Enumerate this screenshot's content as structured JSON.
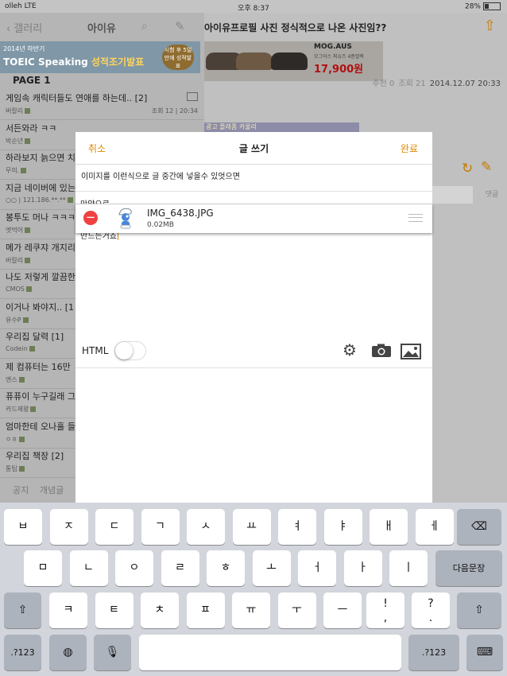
{
  "status": {
    "carrier": "olleh",
    "network": "LTE",
    "time": "오후 8:37",
    "battery": "28%"
  },
  "left": {
    "back": "갤러리",
    "title": "아이유",
    "banner": {
      "year": "2014년 하반기",
      "title_white": "TOEIC Speaking ",
      "title_yellow": "성적조기발표",
      "badge": "시험 후 5일 만에 성적발표"
    },
    "page": "PAGE 1",
    "posts": [
      {
        "title": "게임속 캐릭터들도 연애를 하는데..",
        "count": "[2]",
        "author": "버칼리",
        "stats": "조회 12 | 20:34",
        "image": true
      },
      {
        "title": "서든와라 ㅋㅋ",
        "count": "",
        "author": "박순년",
        "stats": ""
      },
      {
        "title": "하라보지 늙으면 치",
        "count": "",
        "author": "무의.",
        "stats": ""
      },
      {
        "title": "지금 네이버에 있는",
        "count": "",
        "author": "○○ | 121.186.**.**",
        "stats": ""
      },
      {
        "title": "봉투도 머나 ㅋㅋㅋ",
        "count": "",
        "author": "엣먹어",
        "stats": ""
      },
      {
        "title": "메가 레쿠쟈 개지리",
        "count": "",
        "author": "버칼리",
        "stats": ""
      },
      {
        "title": "나도 저렇게 깔끔한",
        "count": "",
        "author": "CMOS",
        "stats": ""
      },
      {
        "title": "이거나 봐야지..",
        "count": "[1",
        "author": "유수P",
        "stats": ""
      },
      {
        "title": "우리집 달력",
        "count": "[1]",
        "author": "Codein",
        "stats": ""
      },
      {
        "title": "제 컴퓨터는 16만",
        "count": "",
        "author": "앤스",
        "stats": ""
      },
      {
        "title": "퓨퓨이 누구길래 그",
        "count": "",
        "author": "카드제왕",
        "stats": ""
      },
      {
        "title": "엄마한테 오나홀 들",
        "count": "",
        "author": "ㅇㅎ",
        "stats": ""
      },
      {
        "title": "우리집 책장",
        "count": "[2]",
        "author": "통팁",
        "stats": ""
      }
    ],
    "bottom": {
      "notice": "공지",
      "concept": "개념글"
    }
  },
  "right": {
    "title": "아이유프로필 사진 정식적으로 나온 사진임??",
    "ad": {
      "brand": "MOG.AUS",
      "sub": "모그어스 퍼슈즈 4종컬렉",
      "price": "17,900원"
    },
    "meta": {
      "recommend": "추천 0",
      "views": "조회 21",
      "date": "2014.12.07 20:33"
    },
    "adbar": "광고 플래폼 카울리",
    "reply": "댓글"
  },
  "modal": {
    "cancel": "취소",
    "title": "글 쓰기",
    "done": "완료",
    "subject": "이미지를 이런식으로 글 중간에 넣을수 있엇으면",
    "body_top": "만약으로",
    "body_bottom": "만드는거죠",
    "attachment": {
      "name": "IMG_6438.JPG",
      "size": "0.02MB"
    },
    "html_label": "HTML",
    "html_on": false
  },
  "keyboard": {
    "row1": [
      "ㅂ",
      "ㅈ",
      "ㄷ",
      "ㄱ",
      "ㅅ",
      "ㅛ",
      "ㅕ",
      "ㅑ",
      "ㅐ",
      "ㅔ"
    ],
    "row2": [
      "ㅁ",
      "ㄴ",
      "ㅇ",
      "ㄹ",
      "ㅎ",
      "ㅗ",
      "ㅓ",
      "ㅏ",
      "ㅣ"
    ],
    "return": "다음문장",
    "row3": [
      "ㅋ",
      "ㅌ",
      "ㅊ",
      "ㅍ",
      "ㅠ",
      "ㅜ",
      "ㅡ"
    ],
    "punct1": "!",
    "punct1b": ",",
    "punct2": "?",
    "punct2b": ".",
    "num": ".?123"
  },
  "colors": {
    "accent": "#e08a00",
    "delete": "#f04040"
  }
}
